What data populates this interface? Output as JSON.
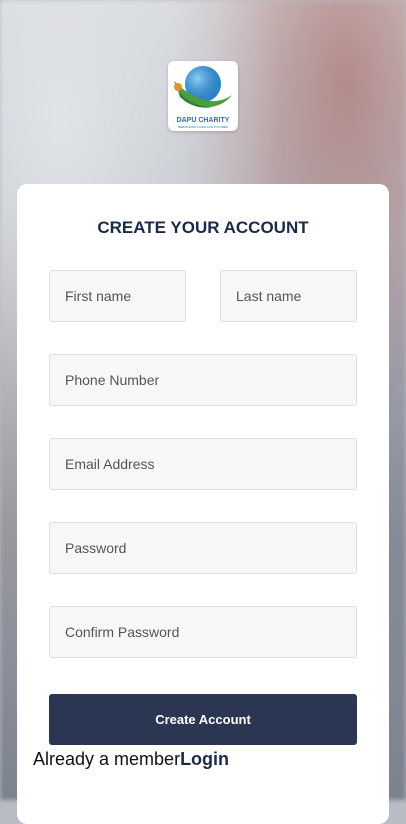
{
  "logo": {
    "icon": "dapu-charity-logo",
    "name": "DAPU CHARITY",
    "tagline": "REBUILDING LIVES FOR FUTURES",
    "colors": {
      "blue": "#2b6fb0",
      "green": "#4a9e3b"
    }
  },
  "form": {
    "title": "CREATE YOUR ACCOUNT",
    "first_name_placeholder": "First name",
    "last_name_placeholder": "Last name",
    "phone_placeholder": "Phone Number",
    "email_placeholder": "Email Address",
    "password_placeholder": "Password",
    "confirm_password_placeholder": "Confirm Password",
    "submit_label": "Create Account"
  },
  "footer": {
    "prompt": "Already a member",
    "login_label": "Login"
  },
  "colors": {
    "primary": "#2b3752",
    "title": "#1c2a47",
    "field_bg": "#f7f7f7"
  }
}
